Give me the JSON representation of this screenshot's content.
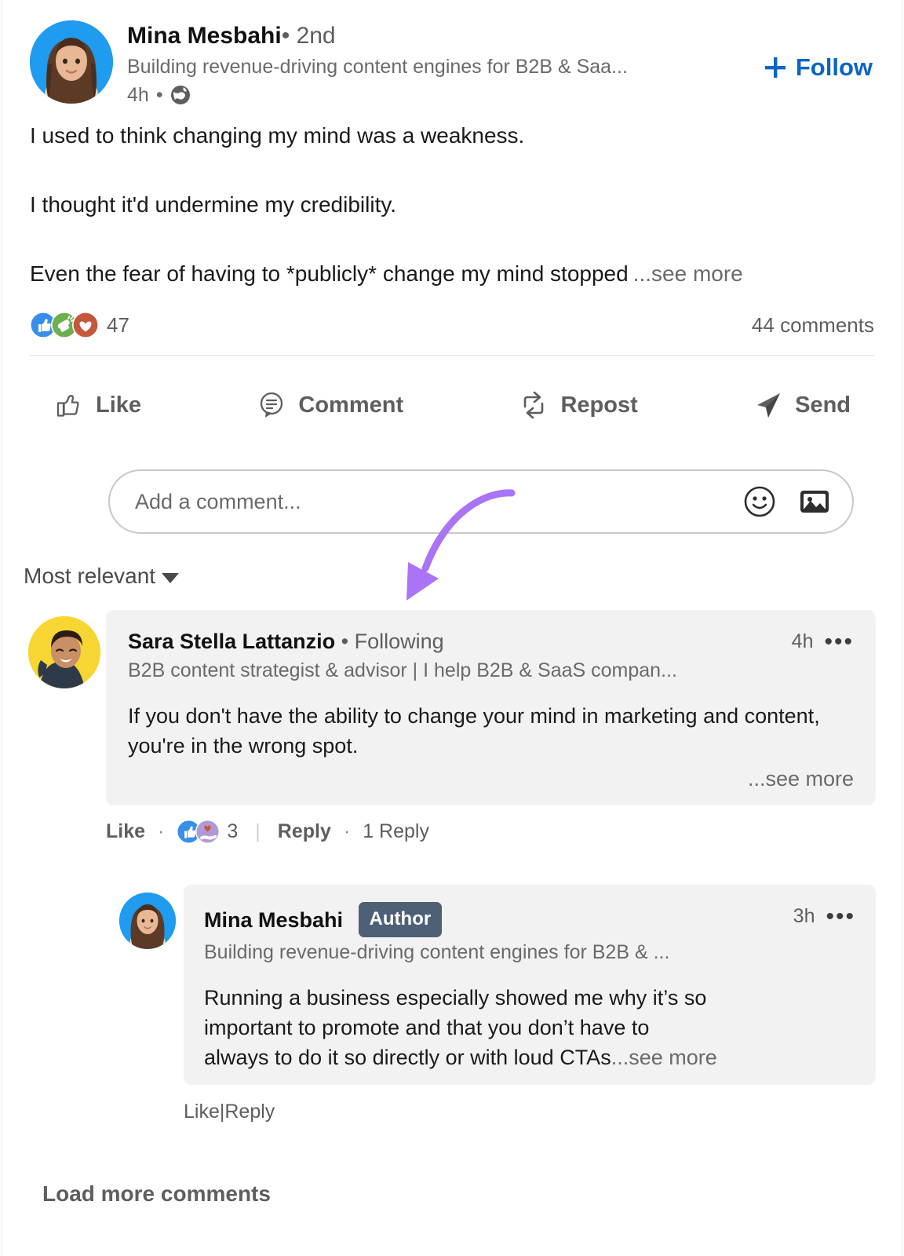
{
  "post": {
    "author": {
      "name": "Mina Mesbahi",
      "separator": "•",
      "degree": "2nd",
      "headline": "Building revenue-driving content engines for B2B & Saa...",
      "time": "4h",
      "meta_separator": "•",
      "visibility_icon": "globe-icon",
      "avatar_bg": "#1f9bf0"
    },
    "follow_button": {
      "label": "Follow",
      "icon": "plus-icon",
      "color": "#0a66c2"
    },
    "body": {
      "paragraph_1": "I used to think changing my mind was a weakness.",
      "paragraph_2": "I thought it'd undermine my credibility.",
      "paragraph_3": "Even the fear of having to *publicly* change my mind stopped",
      "see_more": "...see more"
    },
    "reactions": {
      "icons": [
        "like-reaction-icon",
        "celebrate-reaction-icon",
        "love-reaction-icon"
      ],
      "count": "47"
    },
    "comments_count": "44 comments"
  },
  "actions": [
    {
      "label": "Like",
      "icon": "thumbs-up-icon"
    },
    {
      "label": "Comment",
      "icon": "comment-bubble-icon"
    },
    {
      "label": "Repost",
      "icon": "repost-icon"
    },
    {
      "label": "Send",
      "icon": "send-icon"
    }
  ],
  "comment_input": {
    "placeholder": "Add a comment...",
    "value": "",
    "emoji_icon": "emoji-icon",
    "image_icon": "image-icon"
  },
  "sort": {
    "label": "Most relevant",
    "icon": "chevron-down-icon"
  },
  "comments": [
    {
      "author_name": "Sara Stella Lattanzio",
      "separator": "•",
      "relationship": "Following",
      "headline": "B2B content strategist & advisor | I help B2B & SaaS compan...",
      "time": "4h",
      "menu_icon": "more-options-icon",
      "text": "If you don't have the ability to change your mind in marketing and content, you're in the wrong spot.",
      "see_more": "...see more",
      "avatar_bg": "#f7d633",
      "actions": {
        "like": "Like",
        "dot": "·",
        "reaction_icons": [
          "like-reaction-icon",
          "support-reaction-icon"
        ],
        "reaction_count": "3",
        "reply": "Reply",
        "replies_count": "1 Reply"
      }
    }
  ],
  "reply": {
    "author_name": "Mina Mesbahi",
    "author_badge": "Author",
    "headline": "Building revenue-driving content engines for B2B & ...",
    "time": "3h",
    "menu_icon": "more-options-icon",
    "line_1": "Running a business especially showed me why it’s so",
    "line_2": "important to promote and that you don’t have to",
    "line_3": "always to do it so directly or with loud CTAs",
    "see_more": "...see more",
    "avatar_bg": "#1f9bf0",
    "actions": {
      "like": "Like",
      "reply": "Reply"
    }
  },
  "load_more": "Load more comments",
  "annotation": {
    "type": "curved-arrow",
    "color": "#a974f5"
  }
}
